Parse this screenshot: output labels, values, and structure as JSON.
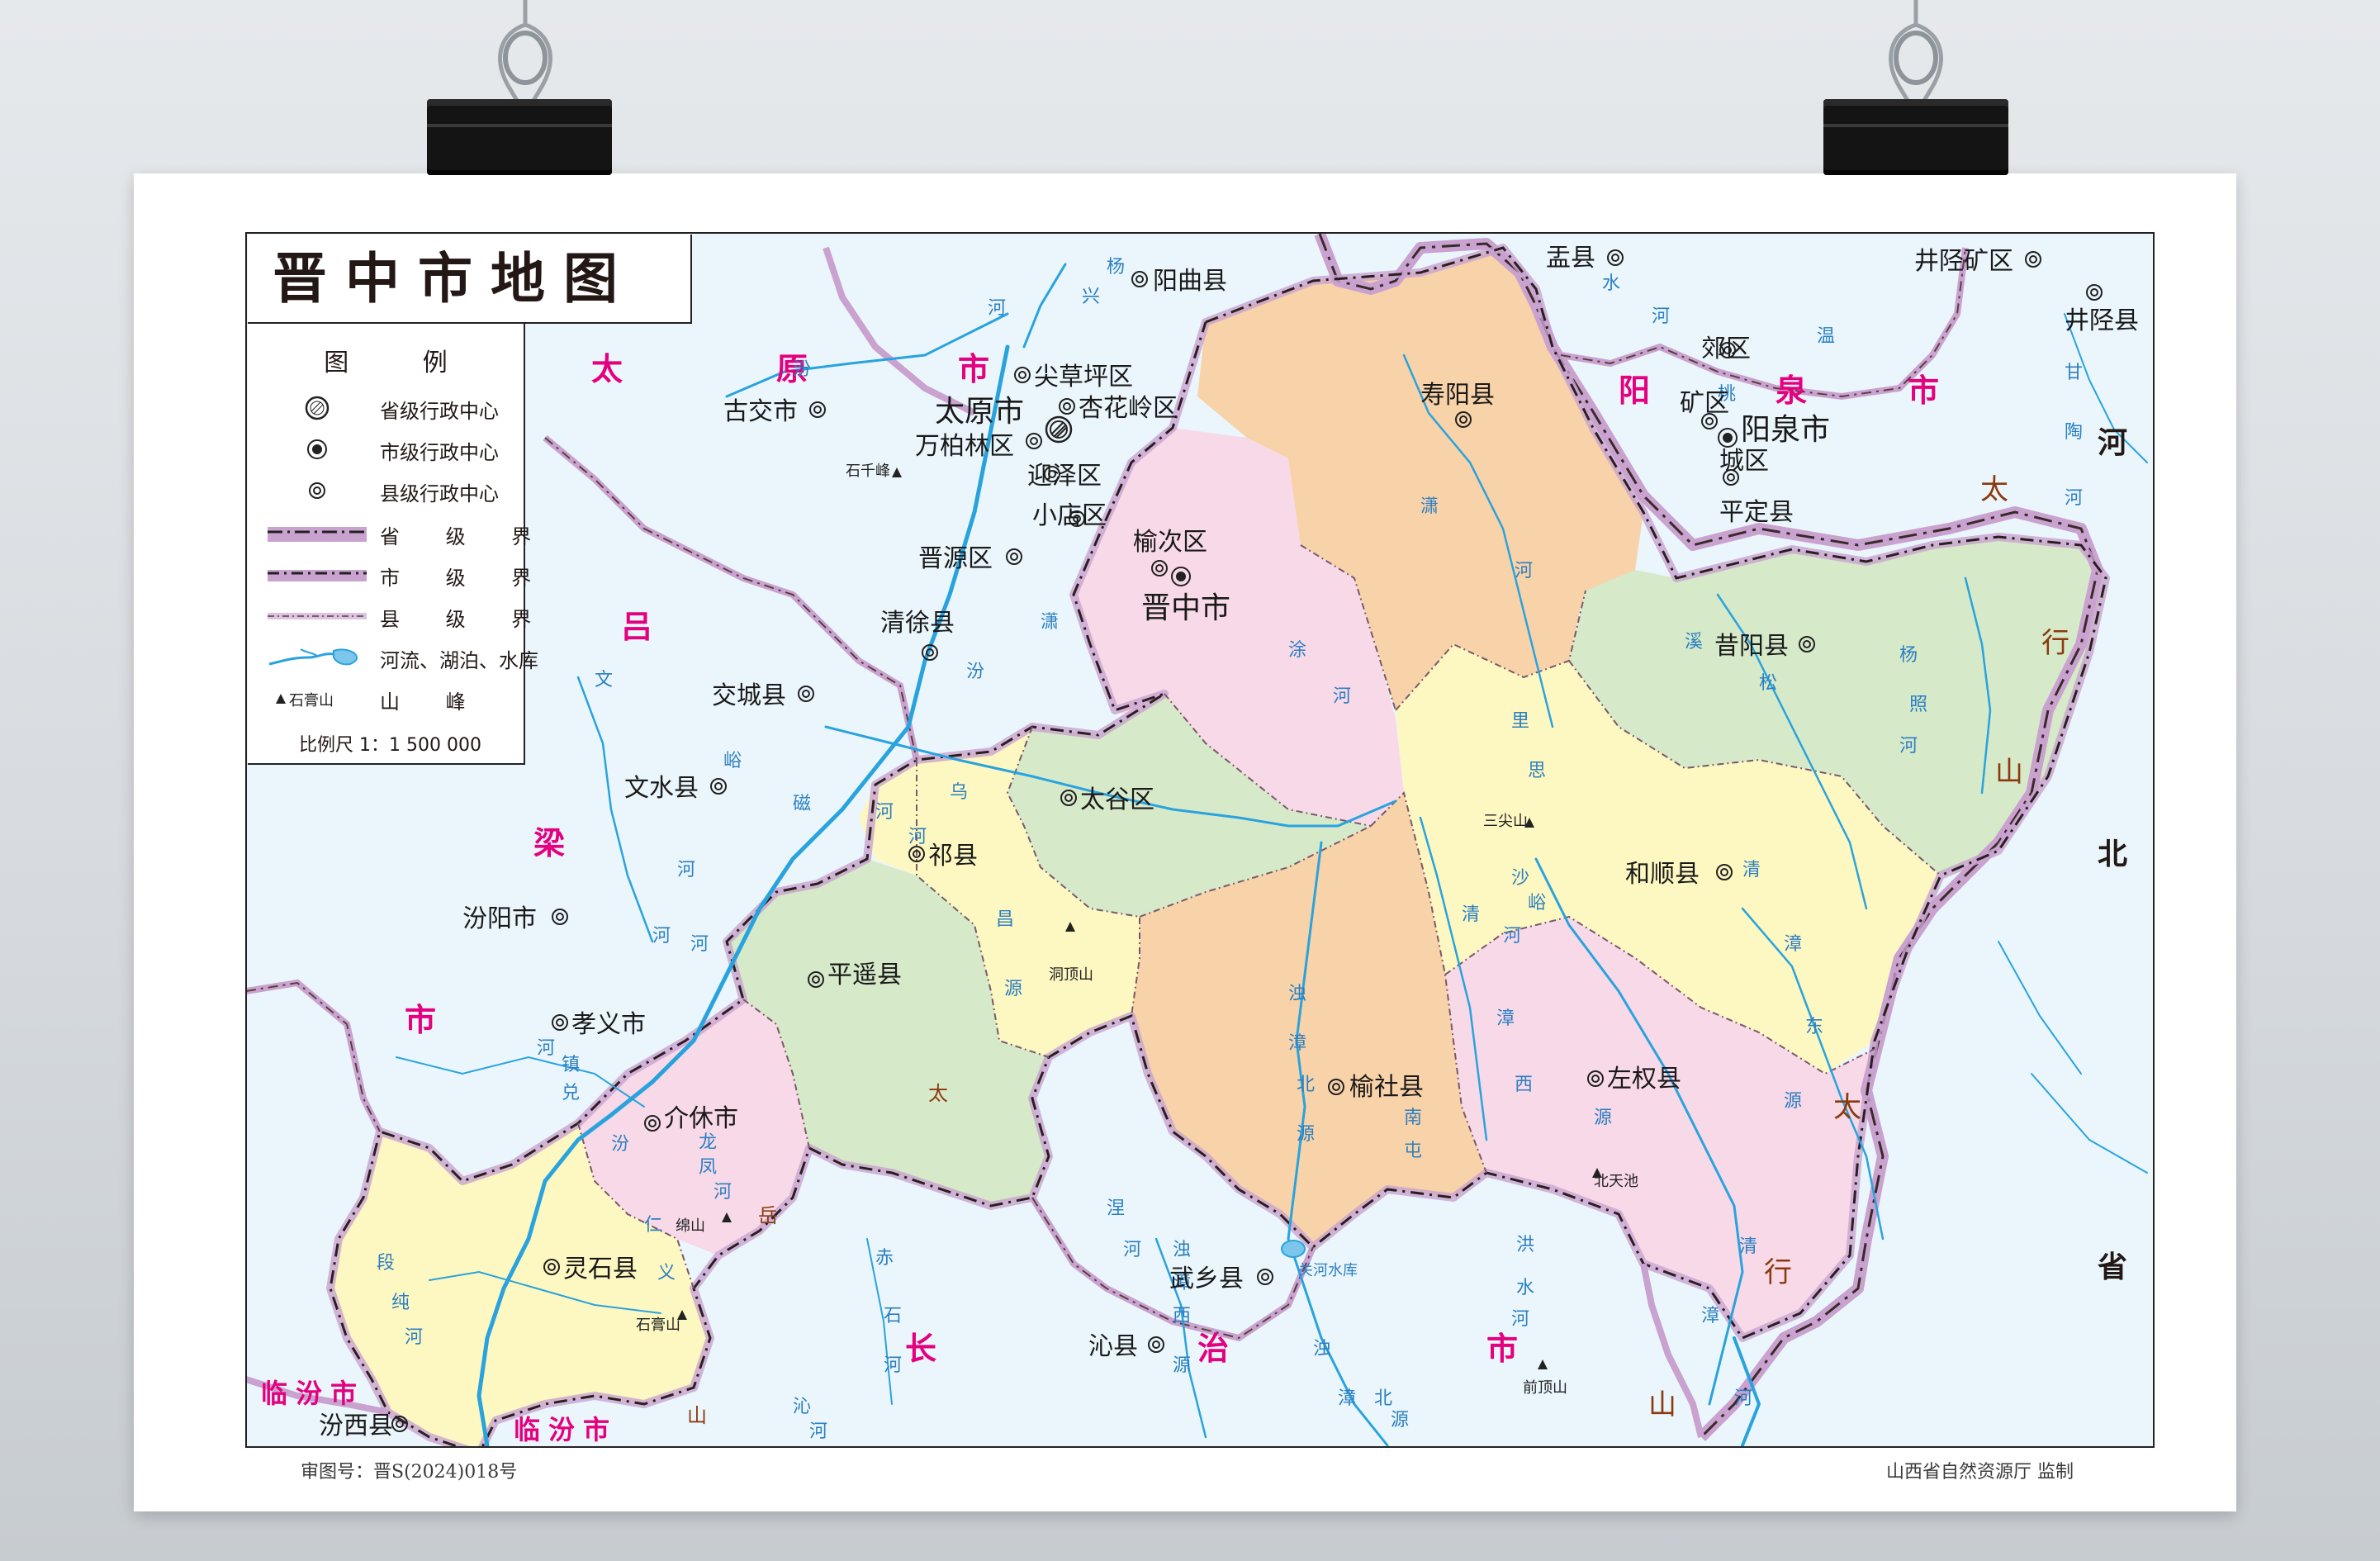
{
  "map": {
    "title": "晋中市地图",
    "colors": {
      "pink": "#f8d9e8",
      "orange": "#f8d2a8",
      "green": "#d6e9c9",
      "yellow": "#fdf7c1",
      "outside": "#eaf6fc",
      "province_border": "#c9a2cf",
      "river": "#29a3de",
      "region_label": "#e4007f"
    },
    "legend": {
      "heading": "图 例",
      "items": [
        {
          "label": "省级行政中心",
          "icon": "provincial-capital-icon"
        },
        {
          "label": "市级行政中心",
          "icon": "city-seat-icon"
        },
        {
          "label": "县级行政中心",
          "icon": "county-seat-icon"
        },
        {
          "label": "省 级 界",
          "icon": "province-boundary-icon"
        },
        {
          "label": "市 级 界",
          "icon": "city-boundary-icon"
        },
        {
          "label": "县 级 界",
          "icon": "county-boundary-icon"
        },
        {
          "label": "河流、湖泊、水库",
          "icon": "river-lake-icon"
        },
        {
          "label": "山 峰",
          "icon": "mountain-peak-icon"
        }
      ],
      "peak_sample": "石膏山",
      "scale": "比例尺 1：1 500 000"
    },
    "footer": {
      "review_number": "审图号：晋S(2024)018号",
      "supervisor": "山西省自然资源厅  监制"
    },
    "regions": [
      "太",
      "原",
      "市",
      "阳",
      "泉",
      "市",
      "河",
      "北",
      "省",
      "吕",
      "梁",
      "市",
      "长",
      "治",
      "市",
      "临汾市",
      "临汾市"
    ],
    "cities": {
      "yuci": "榆次区",
      "jinzhong": "晋中市",
      "taigu": "太谷区",
      "qixian": "祁县",
      "pingyao": "平遥县",
      "jiexiu": "介休市",
      "lingshi": "灵石县",
      "shouyang": "寿阳县",
      "xiyang": "昔阳县",
      "heshun": "和顺县",
      "zuoquan": "左权县",
      "yushe": "榆社县",
      "taiyuan": "太原市",
      "jiancaoping": "尖草坪区",
      "xinghualing": "杏花岭区",
      "wanbailin": "万柏林区",
      "yingze": "迎泽区",
      "xiaodian": "小店区",
      "jinyuan": "晋源区",
      "qingxu": "清徐县",
      "gujiao": "古交市",
      "yangqu": "阳曲县",
      "jiaocheng": "交城县",
      "wenshui": "文水县",
      "fenyang": "汾阳市",
      "xiaoyi": "孝义市",
      "fenxi": "汾西县",
      "qinxian": "沁县",
      "wuxiang": "武乡县",
      "yuxian": "盂县",
      "yangquan": "阳泉市",
      "jiaoqu": "郊区",
      "kuangqu": "矿区",
      "chengqu": "城区",
      "pingding": "平定县",
      "jingxingkuang": "井陉矿区",
      "jingxing": "井陉县"
    },
    "peaks": [
      "石千峰",
      "三尖山",
      "洞顶山",
      "绵山",
      "石膏山",
      "北天池",
      "前顶山"
    ],
    "reservoir": "关河水库",
    "mountain_labels": [
      "太",
      "行",
      "山",
      "太",
      "行",
      "山",
      "太",
      "岳",
      "山"
    ]
  }
}
